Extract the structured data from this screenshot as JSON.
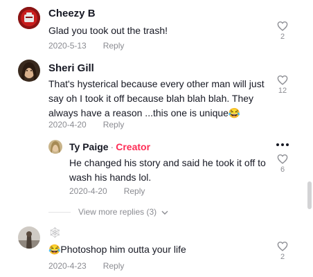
{
  "comments": [
    {
      "username": "Cheezy B",
      "text": "Glad you took out the trash!",
      "date": "2020-5-13",
      "reply_label": "Reply",
      "likes": "2"
    },
    {
      "username": "Sheri Gill",
      "text": "That's hysterical because every other man will just say oh I took it off because blah blah blah. They always have a reason ...this one is unique😂",
      "date": "2020-4-20",
      "reply_label": "Reply",
      "likes": "12",
      "reply": {
        "username": "Ty Paige",
        "badge": "Creator",
        "separator": "·",
        "text": "He changed his story and said he took it off to wash his hands lol.",
        "date": "2020-4-20",
        "reply_label": "Reply",
        "likes": "6"
      },
      "more_options_icon": "ellipsis-icon",
      "view_more": "View more replies (3)"
    },
    {
      "username": "🕸",
      "text": "😂Photoshop him outta your life",
      "date": "2020-4-23",
      "reply_label": "Reply",
      "likes": "2"
    }
  ],
  "icons": {
    "like": "heart-outline-icon",
    "expand": "chevron-down-icon"
  },
  "colors": {
    "creator": "#fe2c55",
    "meta": "#8a8b91",
    "text": "#161823"
  }
}
